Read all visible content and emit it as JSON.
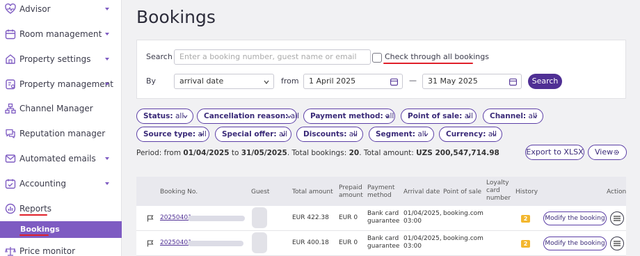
{
  "sidebar": {
    "items": [
      {
        "label": "Advisor",
        "icon": "heart-pulse-icon",
        "has_chevron": true
      },
      {
        "label": "Room management",
        "icon": "calendar-icon",
        "has_chevron": true
      },
      {
        "label": "Property settings",
        "icon": "house-icon",
        "has_chevron": true
      },
      {
        "label": "Property management",
        "icon": "clipboard-icon",
        "has_chevron": true
      },
      {
        "label": "Channel Manager",
        "icon": "network-icon",
        "has_chevron": false
      },
      {
        "label": "Reputation manager",
        "icon": "chat-icon",
        "has_chevron": false
      },
      {
        "label": "Automated emails",
        "icon": "envelope-icon",
        "has_chevron": true
      },
      {
        "label": "Accounting",
        "icon": "calendar-check-icon",
        "has_chevron": true
      },
      {
        "label": "Reports",
        "icon": "chart-icon",
        "has_chevron": false
      },
      {
        "label": "Price monitor",
        "icon": "scale-icon",
        "has_chevron": false
      }
    ],
    "sub_item": "Bookings"
  },
  "page": {
    "title": "Bookings"
  },
  "filters": {
    "search_label": "Search",
    "search_placeholder": "Enter a booking number, guest name or email",
    "check_all_label": "Check through all bookings",
    "by_label": "By",
    "by_value": "arrival date",
    "from_label": "from",
    "from_value": "1 April 2025",
    "dash": "—",
    "to_value": "31 May 2025",
    "search_button": "Search"
  },
  "chips": [
    {
      "key": "Status:",
      "value": "all"
    },
    {
      "key": "Cancellation reason:",
      "value": "all"
    },
    {
      "key": "Payment method:",
      "value": "all"
    },
    {
      "key": "Point of sale:",
      "value": "all"
    },
    {
      "key": "Channel:",
      "value": "all"
    },
    {
      "key": "Source type:",
      "value": "all"
    },
    {
      "key": "Special offer:",
      "value": "all"
    },
    {
      "key": "Discounts:",
      "value": "all"
    },
    {
      "key": "Segment:",
      "value": "all"
    },
    {
      "key": "Currency:",
      "value": "all"
    }
  ],
  "summary": {
    "prefix": "Period: from ",
    "from": "01/04/2025",
    "to_word": " to ",
    "to": "31/05/2025",
    "total_bookings_label": ". Total bookings: ",
    "total_bookings": "20",
    "total_amount_label": ". Total amount: ",
    "total_amount": "UZS 200,547,714.98"
  },
  "actions": {
    "export": "Export to XLSX",
    "view": "View"
  },
  "table": {
    "headers": {
      "booking_no": "Booking No.",
      "guest": "Guest",
      "total_amount": "Total amount",
      "prepaid_1": "Prepaid",
      "prepaid_2": "amount",
      "payment_1": "Payment",
      "payment_2": "method",
      "arrival": "Arrival date",
      "pos": "Point of sale",
      "loyalty_1": "Loyalty",
      "loyalty_2": "card",
      "loyalty_3": "number",
      "history": "History",
      "action": "Action"
    },
    "rows": [
      {
        "booking_no": "20250401",
        "total": "EUR 422.38",
        "prepaid": "EUR 0",
        "payment_1": "Bank card",
        "payment_2": "guarantee",
        "arrival_1": "01/04/2025,",
        "arrival_2": "03:00",
        "pos": "booking.com",
        "history": "2",
        "modify": "Modify the booking"
      },
      {
        "booking_no": "20250401",
        "total": "EUR 400.18",
        "prepaid": "EUR 0",
        "payment_1": "Bank card",
        "payment_2": "guarantee",
        "arrival_1": "01/04/2025,",
        "arrival_2": "03:00",
        "pos": "booking.com",
        "history": "2",
        "modify": "Modify the booking"
      }
    ]
  },
  "colors": {
    "accent": "#4f2f94",
    "sidebar_active": "#7e5bc2",
    "highlight": "#e0202a",
    "badge": "#f3b72e"
  }
}
